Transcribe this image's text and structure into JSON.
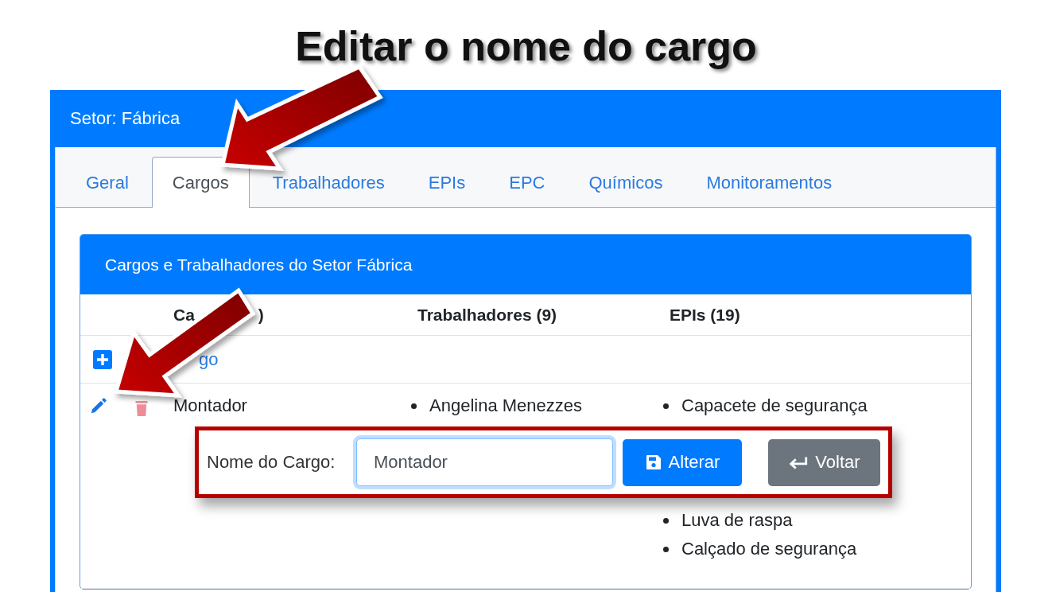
{
  "slide_title": "Editar o nome do cargo",
  "card": {
    "title": "Setor: Fábrica"
  },
  "tabs": [
    {
      "label": "Geral",
      "selected": false
    },
    {
      "label": "Cargos",
      "selected": true
    },
    {
      "label": "Trabalhadores",
      "selected": false
    },
    {
      "label": "EPIs",
      "selected": false
    },
    {
      "label": "EPC",
      "selected": false
    },
    {
      "label": "Químicos",
      "selected": false
    },
    {
      "label": "Monitoramentos",
      "selected": false
    }
  ],
  "panel": {
    "title": "Cargos e Trabalhadores do Setor Fábrica",
    "columns": [
      {
        "fragments": [
          "Ca",
          ")"
        ]
      },
      {
        "label": "Trabalhadores (9)"
      },
      {
        "label": "EPIs (19)"
      }
    ],
    "add_link": {
      "text": "go"
    },
    "rows": [
      {
        "cargo": "Montador",
        "trabalhadores": [
          "Angelina Menezzes"
        ],
        "epis": [
          "Capacete de segurança",
          "Luva de raspa",
          "Calçado de segurança"
        ]
      }
    ]
  },
  "edit_form": {
    "label": "Nome do Cargo:",
    "value": "Montador",
    "focused": true,
    "buttons": [
      {
        "label": "Alterar",
        "kind": "primary"
      },
      {
        "label": "Voltar",
        "kind": "secondary"
      }
    ]
  }
}
